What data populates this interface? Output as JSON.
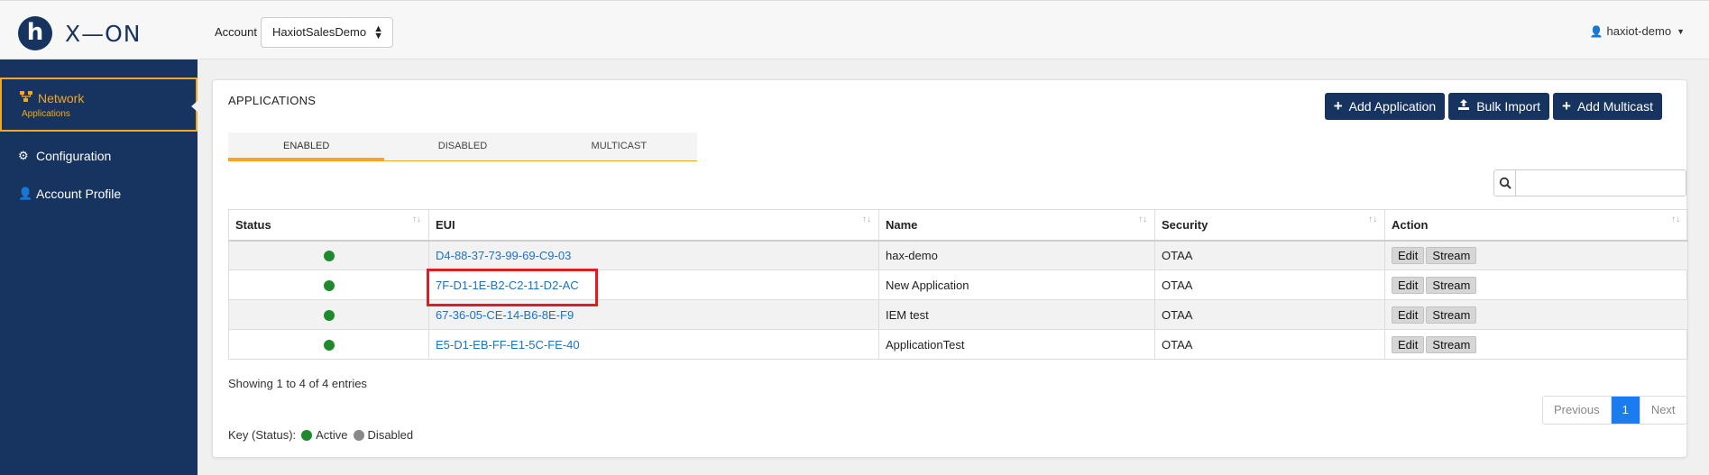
{
  "brand": {
    "mark": "h",
    "name": "X—ON"
  },
  "header": {
    "account_label": "Account",
    "account_selected": "HaxiotSalesDemo",
    "user": "haxiot-demo"
  },
  "sidebar": {
    "items": [
      {
        "label": "Network",
        "sublabel": "Applications",
        "icon": "network-icon",
        "active": true
      },
      {
        "label": "Configuration",
        "icon": "gear-icon"
      },
      {
        "label": "Account Profile",
        "icon": "user-icon"
      }
    ]
  },
  "main": {
    "title": "APPLICATIONS",
    "buttons": {
      "add_application": "Add Application",
      "bulk_import": "Bulk Import",
      "add_multicast": "Add Multicast"
    },
    "tabs": [
      "ENABLED",
      "DISABLED",
      "MULTICAST"
    ],
    "active_tab": "ENABLED",
    "search": {
      "value": "",
      "placeholder": ""
    },
    "table": {
      "columns": [
        "Status",
        "EUI",
        "Name",
        "Security",
        "Action"
      ],
      "rows": [
        {
          "status": "Active",
          "eui": "D4-88-37-73-99-69-C9-03",
          "name": "hax-demo",
          "security": "OTAA"
        },
        {
          "status": "Active",
          "eui": "7F-D1-1E-B2-C2-11-D2-AC",
          "name": "New Application",
          "security": "OTAA"
        },
        {
          "status": "Active",
          "eui": "67-36-05-CE-14-B6-8E-F9",
          "name": "IEM test",
          "security": "OTAA"
        },
        {
          "status": "Active",
          "eui": "E5-D1-EB-FF-E1-5C-FE-40",
          "name": "ApplicationTest",
          "security": "OTAA"
        }
      ],
      "actions": {
        "edit": "Edit",
        "stream": "Stream"
      }
    },
    "showing": "Showing 1 to 4 of 4 entries",
    "pagination": {
      "previous": "Previous",
      "current": "1",
      "next": "Next"
    },
    "key": {
      "label": "Key (Status):",
      "active": "Active",
      "disabled": "Disabled"
    }
  },
  "colors": {
    "navy": "#16345f",
    "accent": "#f5a623",
    "active_status": "#1f8a2d",
    "disabled_status": "#888888",
    "link": "#1a73c8",
    "highlight": "#e11b22"
  }
}
